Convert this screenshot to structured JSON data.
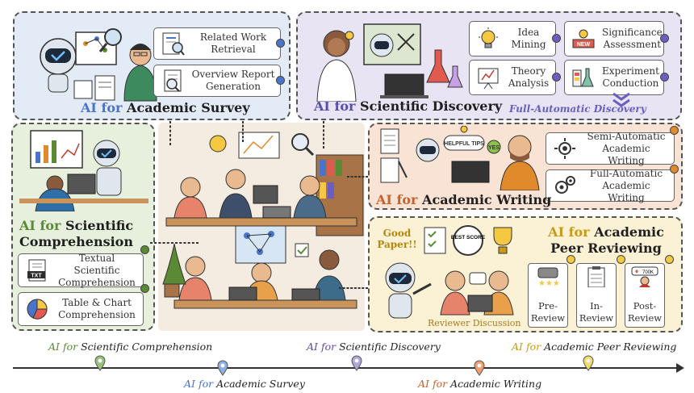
{
  "survey": {
    "title_ai": "AI for",
    "title_rest": "Academic Survey",
    "items": [
      {
        "label": "Related Work Retrieval",
        "icon": "document-search-icon"
      },
      {
        "label": "Overview Report Generation",
        "icon": "report-magnifier-icon"
      }
    ],
    "color": "#4a74c9"
  },
  "discovery": {
    "title_ai": "AI for",
    "title_rest": "Scientific Discovery",
    "subtitle": "Full-Automatic Discovery",
    "items": [
      {
        "label": "Idea Mining",
        "icon": "lightbulb-icon"
      },
      {
        "label": "Significance Assessment",
        "icon": "new-badge-icon"
      },
      {
        "label": "Theory Analysis",
        "icon": "chalkboard-icon"
      },
      {
        "label": "Experiment Conduction",
        "icon": "lab-flask-icon"
      }
    ],
    "color": "#5a4fa8"
  },
  "comprehension": {
    "title_ai": "AI for",
    "title_rest": "Scientific Comprehension",
    "items": [
      {
        "label": "Textual Scientific Comprehension",
        "icon": "txt-file-icon"
      },
      {
        "label": "Table & Chart Comprehension",
        "icon": "pie-chart-icon"
      }
    ],
    "color": "#5b8a34"
  },
  "writing": {
    "title_ai": "AI for",
    "title_rest": "Academic Writing",
    "items": [
      {
        "label": "Semi-Automatic Academic Writing",
        "icon": "gear-network-icon"
      },
      {
        "label": "Full-Automatic Academic Writing",
        "icon": "gears-icon"
      }
    ],
    "bubble_tips": "HELPFUL TIPS",
    "bubble_yes": "YES",
    "color": "#c9612a"
  },
  "review": {
    "title_ai": "AI for",
    "title_rest": "Academic Peer Reviewing",
    "good_paper": "Good Paper!!",
    "best_score": "BEST SCORE",
    "discussion": "Reviewer Discussion",
    "items": [
      {
        "label": "Pre-Review",
        "icon": "stars-rating-icon"
      },
      {
        "label": "In-Review",
        "icon": "clipboard-icon"
      },
      {
        "label": "Post-Review",
        "icon": "popularity-icon"
      }
    ],
    "popularity": "700K",
    "color": "#c99a14"
  },
  "timeline": {
    "items": [
      {
        "ai": "AI for",
        "rest": "Scientific Comprehension",
        "color": "#5b8a34"
      },
      {
        "ai": "AI for",
        "rest": "Academic Survey",
        "color": "#4a74c9"
      },
      {
        "ai": "AI for",
        "rest": "Scientific Discovery",
        "color": "#5a4fa8"
      },
      {
        "ai": "AI for",
        "rest": "Academic Writing",
        "color": "#c9612a"
      },
      {
        "ai": "AI for",
        "rest": "Academic Peer Reviewing",
        "color": "#c99a14"
      }
    ]
  }
}
